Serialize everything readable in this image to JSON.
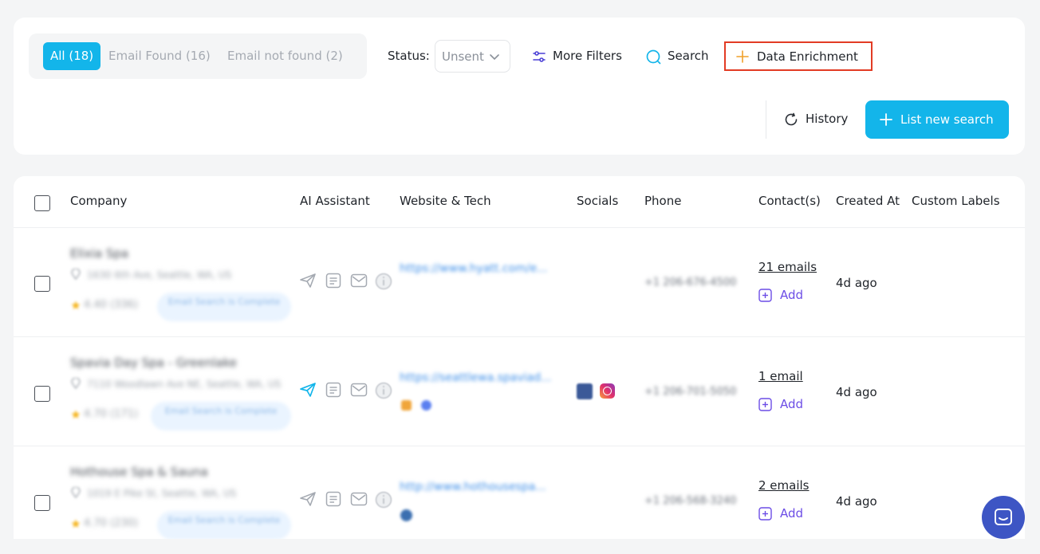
{
  "tabs": [
    {
      "label": "All (18)",
      "active": true
    },
    {
      "label": "Email Found (16)",
      "active": false
    },
    {
      "label": "Email not found (2)",
      "active": false
    }
  ],
  "status": {
    "label": "Status:",
    "value": "Unsent"
  },
  "toolbar": {
    "more_filters": "More Filters",
    "search": "Search",
    "data_enrichment": "Data Enrichment",
    "history": "History",
    "new_search": "List new search"
  },
  "table": {
    "headers": {
      "company": "Company",
      "ai": "AI Assistant",
      "website": "Website & Tech",
      "socials": "Socials",
      "phone": "Phone",
      "contacts": "Contact(s)",
      "created": "Created At",
      "labels": "Custom Labels"
    },
    "rows": [
      {
        "company": "Elixia Spa",
        "address": "1630 6th Ave, Seattle, WA, US",
        "rating": "4.40 (336)",
        "badge": "Email Search is Complete",
        "website": "https://www.hyatt.com/e...",
        "phone": "+1 206-676-4500",
        "emails": "21 emails",
        "add": "Add",
        "created": "4d ago"
      },
      {
        "company": "Spavia Day Spa - Greenlake",
        "address": "7110 Woodlawn Ave NE, Seattle, WA, US",
        "rating": "4.70 (171)",
        "badge": "Email Search is Complete",
        "website": "https://seattlewa.spaviad...",
        "phone": "+1 206-701-5050",
        "emails": "1 email",
        "add": "Add",
        "created": "4d ago"
      },
      {
        "company": "Hothouse Spa & Sauna",
        "address": "1019 E Pike St, Seattle, WA, US",
        "rating": "4.70 (230)",
        "badge": "Email Search is Complete",
        "website": "http://www.hothousespa...",
        "phone": "+1 206-568-3240",
        "emails": "2 emails",
        "add": "Add",
        "created": "4d ago"
      }
    ]
  },
  "colors": {
    "accent": "#13b5ea",
    "highlight_border": "#e23b24",
    "purple": "#6c4de6",
    "chat": "#3d55c4"
  },
  "icons": [
    "sliders-icon",
    "search-icon",
    "plus-icon",
    "history-icon",
    "send-icon",
    "document-icon",
    "mail-icon",
    "info-icon",
    "location-icon",
    "star-icon",
    "facebook-icon",
    "instagram-icon",
    "add-square-icon",
    "chat-icon",
    "chevron-down-icon"
  ]
}
